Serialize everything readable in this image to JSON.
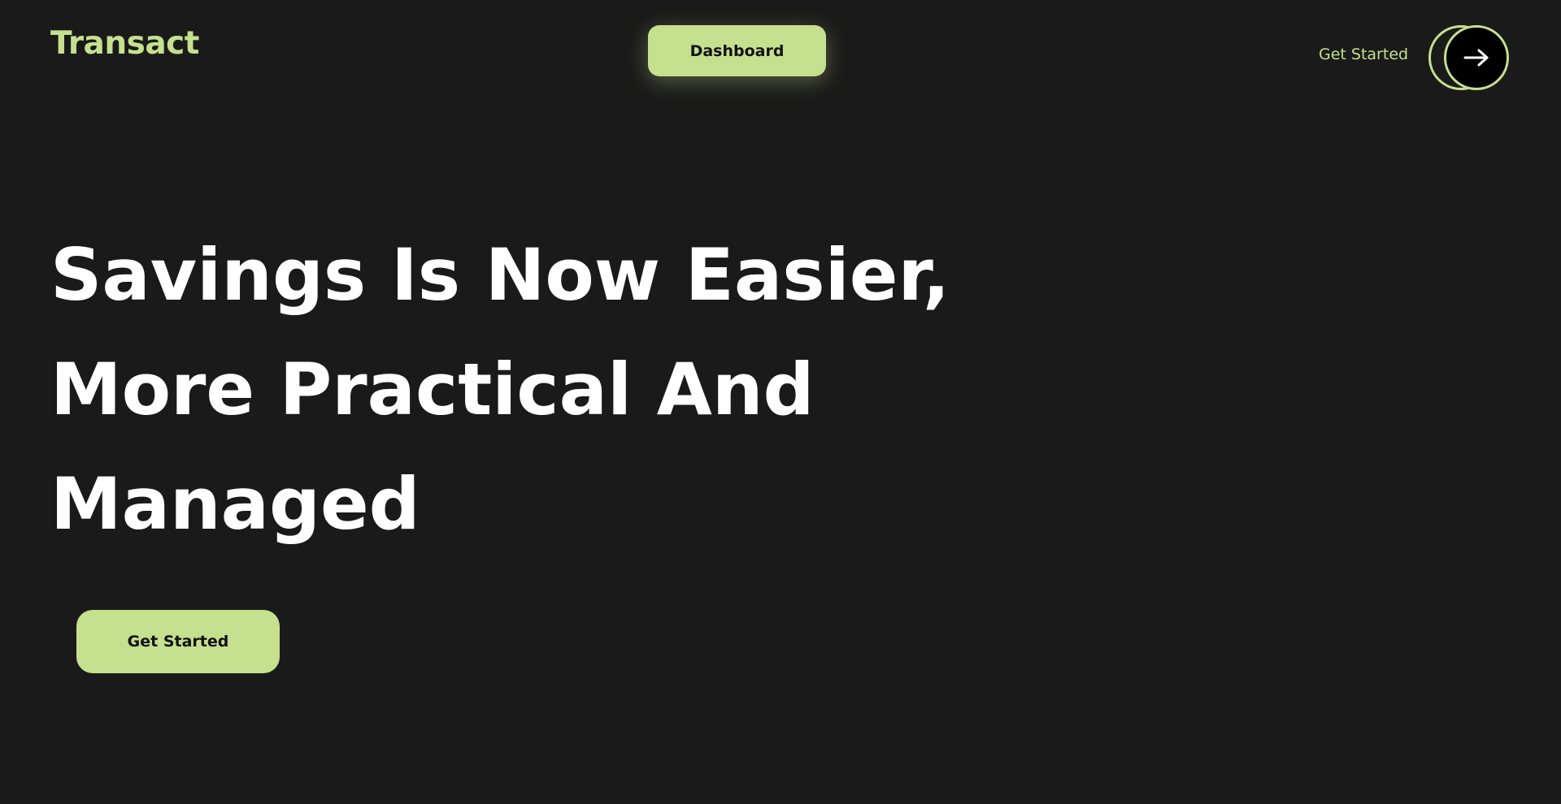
{
  "header": {
    "logo": "Transact",
    "dashboard_label": "Dashboard",
    "get_started_label": "Get Started",
    "arrow_icon": "arrow-right-icon"
  },
  "hero": {
    "title_lines": [
      "Savings Is Now Easier,",
      "More Practical And",
      "Managed"
    ],
    "cta_label": "Get Started"
  },
  "colors": {
    "background": "#1a1a1a",
    "accent": "#c5e08e",
    "text": "#ffffff",
    "button_text": "#111111"
  }
}
